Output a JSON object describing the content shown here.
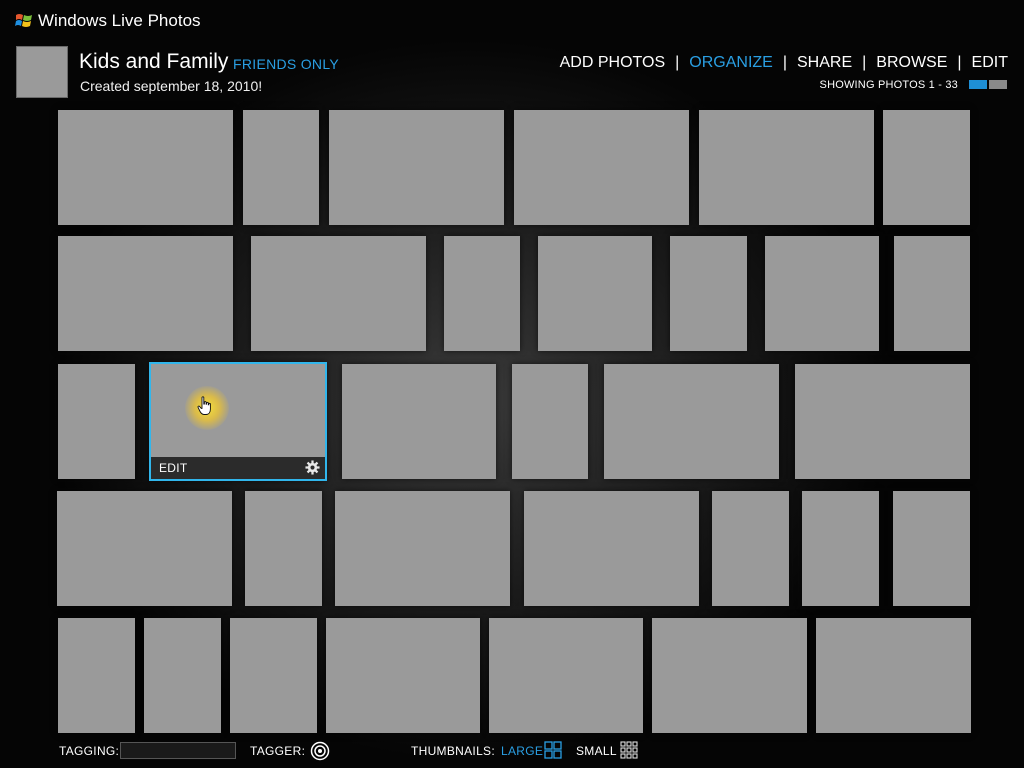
{
  "app": {
    "title": "Windows Live Photos"
  },
  "album": {
    "title": "Kids and Family",
    "privacy": "FRIENDS ONLY",
    "created": "Created september 18, 2010!"
  },
  "nav": {
    "items": [
      "ADD PHOTOS",
      "ORGANIZE",
      "SHARE",
      "BROWSE",
      "EDIT"
    ],
    "active": "ORGANIZE"
  },
  "status": {
    "showing": "SHOWING PHOTOS 1 - 33",
    "pager_colors": [
      "#1e8fd6",
      "#8a8a8a"
    ]
  },
  "photos": {
    "count": 33,
    "selected_index": 14
  },
  "selected_tile": {
    "edit_label": "EDIT"
  },
  "bottom": {
    "tagging_label": "TAGGING:",
    "tagging_value": "",
    "tagger_label": "TAGGER:",
    "thumbnails_label": "THUMBNAILS:",
    "large_label": "LARGE",
    "small_label": "SMALL"
  },
  "colors": {
    "accent": "#2a9fe3",
    "selection_border": "#31b6ec",
    "tile": "#9a9a9a",
    "hover_glow": "#f5df3a"
  }
}
